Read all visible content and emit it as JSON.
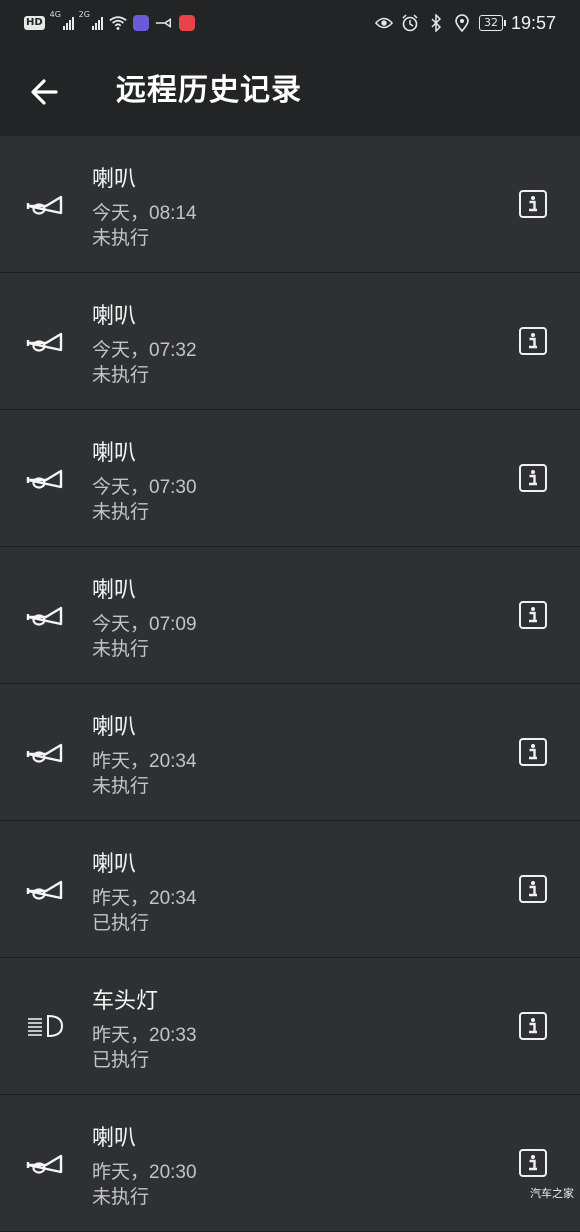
{
  "status_bar": {
    "network_badge": "HD",
    "network_types": [
      "4G",
      "2G"
    ],
    "battery": "32",
    "time": "19:57"
  },
  "app_bar": {
    "title": "远程历史记录"
  },
  "records": [
    {
      "icon": "horn-icon",
      "title": "喇叭",
      "time": "今天，08:14",
      "status": "未执行"
    },
    {
      "icon": "horn-icon",
      "title": "喇叭",
      "time": "今天，07:32",
      "status": "未执行"
    },
    {
      "icon": "horn-icon",
      "title": "喇叭",
      "time": "今天，07:30",
      "status": "未执行"
    },
    {
      "icon": "horn-icon",
      "title": "喇叭",
      "time": "今天，07:09",
      "status": "未执行"
    },
    {
      "icon": "horn-icon",
      "title": "喇叭",
      "time": "昨天，20:34",
      "status": "未执行"
    },
    {
      "icon": "horn-icon",
      "title": "喇叭",
      "time": "昨天，20:34",
      "status": "已执行"
    },
    {
      "icon": "headlight-icon",
      "title": "车头灯",
      "time": "昨天，20:33",
      "status": "已执行"
    },
    {
      "icon": "horn-icon",
      "title": "喇叭",
      "time": "昨天，20:30",
      "status": "未执行"
    }
  ],
  "watermark": "汽车之家",
  "colors": {
    "background": "#2f3033",
    "bars": "#232426",
    "divider": "#1e1f21",
    "secondary_text": "#c4c4c4"
  }
}
